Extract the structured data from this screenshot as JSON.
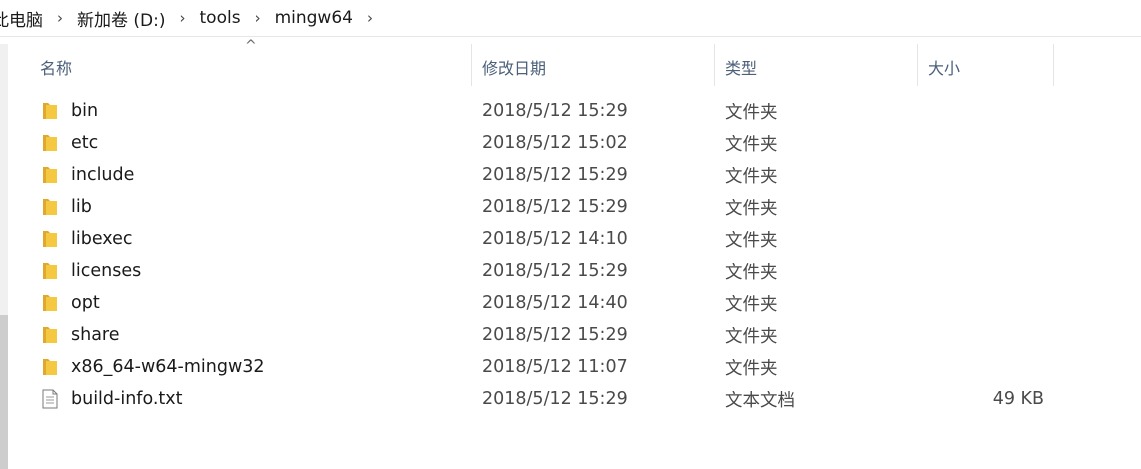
{
  "breadcrumb": {
    "items": [
      "此电脑",
      "新加卷 (D:)",
      "tools",
      "mingw64"
    ],
    "separator": "›"
  },
  "columns": {
    "name": "名称",
    "date": "修改日期",
    "type": "类型",
    "size": "大小",
    "sort_indicator": "^"
  },
  "files": [
    {
      "name": "bin",
      "date": "2018/5/12 15:29",
      "type": "文件夹",
      "size": "",
      "icon": "folder-icon"
    },
    {
      "name": "etc",
      "date": "2018/5/12 15:02",
      "type": "文件夹",
      "size": "",
      "icon": "folder-icon"
    },
    {
      "name": "include",
      "date": "2018/5/12 15:29",
      "type": "文件夹",
      "size": "",
      "icon": "folder-icon"
    },
    {
      "name": "lib",
      "date": "2018/5/12 15:29",
      "type": "文件夹",
      "size": "",
      "icon": "folder-icon"
    },
    {
      "name": "libexec",
      "date": "2018/5/12 14:10",
      "type": "文件夹",
      "size": "",
      "icon": "folder-icon"
    },
    {
      "name": "licenses",
      "date": "2018/5/12 15:29",
      "type": "文件夹",
      "size": "",
      "icon": "folder-icon"
    },
    {
      "name": "opt",
      "date": "2018/5/12 14:40",
      "type": "文件夹",
      "size": "",
      "icon": "folder-icon"
    },
    {
      "name": "share",
      "date": "2018/5/12 15:29",
      "type": "文件夹",
      "size": "",
      "icon": "folder-icon"
    },
    {
      "name": "x86_64-w64-mingw32",
      "date": "2018/5/12 11:07",
      "type": "文件夹",
      "size": "",
      "icon": "folder-icon"
    },
    {
      "name": "build-info.txt",
      "date": "2018/5/12 15:29",
      "type": "文本文档",
      "size": "49 KB",
      "icon": "text-file-icon"
    }
  ],
  "colors": {
    "header_text": "#4c607a",
    "folder_yellow": "#f5c842",
    "folder_dark": "#e0a82e"
  }
}
